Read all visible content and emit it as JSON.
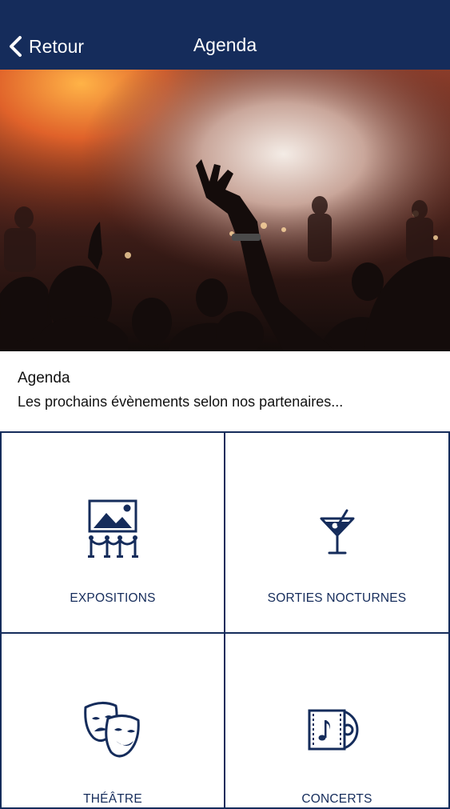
{
  "navbar": {
    "back_label": "Retour",
    "title": "Agenda",
    "background": "#152c5b"
  },
  "hero": {
    "icon": "concert-crowd-photo"
  },
  "intro": {
    "title": "Agenda",
    "subtitle": "Les prochains évènements selon nos partenaires..."
  },
  "categories": [
    {
      "label": "EXPOSITIONS",
      "icon": "gallery-icon"
    },
    {
      "label": "SORTIES NOCTURNES",
      "icon": "cocktail-icon"
    },
    {
      "label": "THÉÂTRE",
      "icon": "theater-masks-icon"
    },
    {
      "label": "CONCERTS",
      "icon": "music-album-icon"
    }
  ],
  "colors": {
    "accent": "#152c5b",
    "text": "#111111",
    "background": "#ffffff"
  }
}
